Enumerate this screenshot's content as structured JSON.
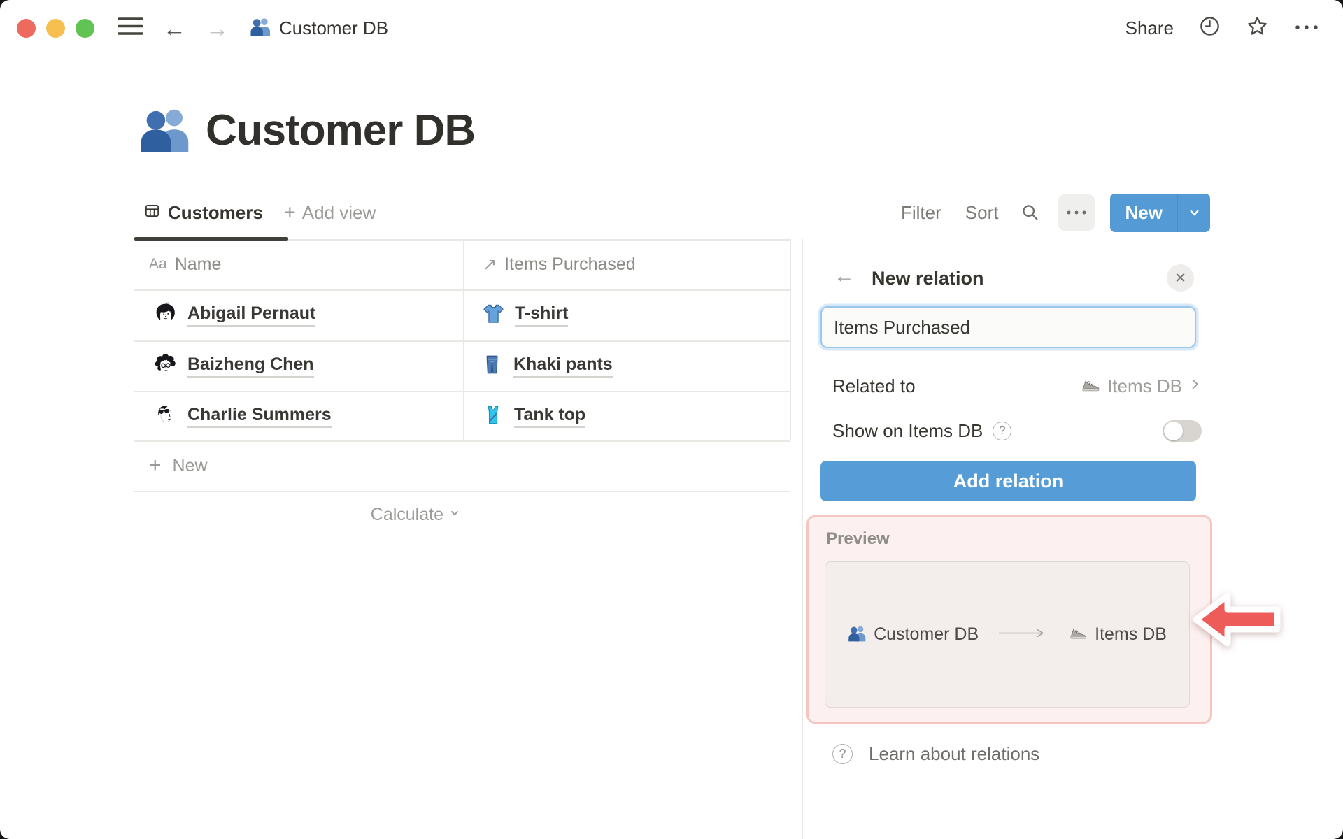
{
  "topbar": {
    "breadcrumb": "Customer DB",
    "share_label": "Share"
  },
  "page": {
    "title": "Customer DB"
  },
  "toolbar": {
    "view_tab": "Customers",
    "add_view": "Add view",
    "filter": "Filter",
    "sort": "Sort",
    "new_button": "New"
  },
  "table": {
    "header": {
      "name_icon_label": "Aa",
      "name": "Name",
      "items": "Items Purchased"
    },
    "rows": [
      {
        "name": "Abigail Pernaut",
        "item": "T-shirt"
      },
      {
        "name": "Baizheng Chen",
        "item": "Khaki pants"
      },
      {
        "name": "Charlie Summers",
        "item": "Tank top"
      }
    ],
    "new_row": "New",
    "calculate": "Calculate"
  },
  "panel": {
    "title": "New relation",
    "relation_name_value": "Items Purchased",
    "related_to_label": "Related to",
    "related_to_value": "Items DB",
    "show_on_label": "Show on Items DB",
    "toggle_state": "off",
    "add_relation_button": "Add relation",
    "preview": {
      "label": "Preview",
      "source": "Customer DB",
      "target": "Items DB"
    },
    "learn_link": "Learn about relations"
  },
  "colors": {
    "accent_blue": "#549bd5",
    "annotation_red": "#ed5c59",
    "preview_bg": "#fcf1f0",
    "preview_border": "#f4c5c1",
    "people_icon_blue": "#3f6fae",
    "text_dark": "#37352f",
    "text_gray": "#9b9a97"
  }
}
